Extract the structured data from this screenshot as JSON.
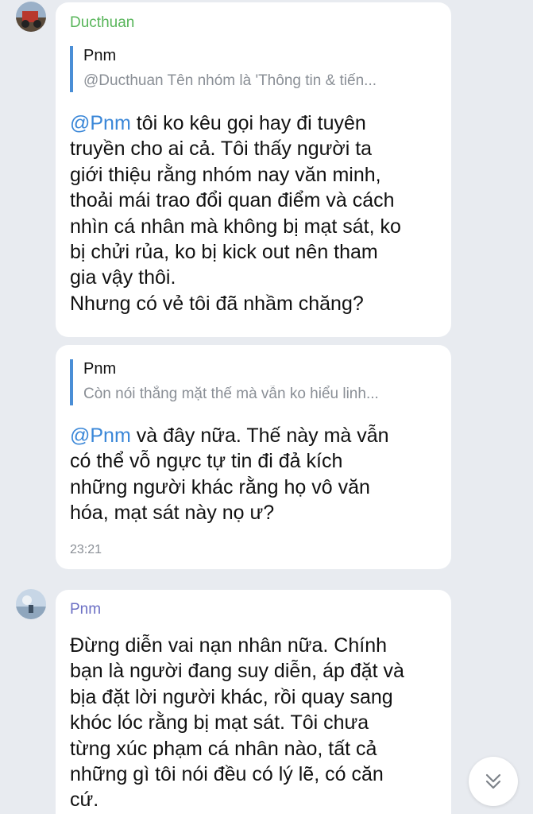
{
  "messages": [
    {
      "sender": "Ducthuan",
      "sender_color": "#58b55a",
      "reply_to": {
        "author": "Pnm",
        "text": "@Ducthuan Tên nhóm là 'Thông tin & tiến..."
      },
      "mention": "@Pnm",
      "lines": [
        " tôi ko kêu gọi hay đi tuyên",
        "truyền cho ai cả. Tôi thấy người ta",
        "giới thiệu rằng nhóm nay văn minh,",
        "thoải mái trao đổi quan điểm và cách",
        "nhìn cá nhân mà không bị mạt sát, ko",
        "bị chửi rủa, ko bị kick out nên tham",
        "gia vậy thôi.",
        "Nhưng có vẻ tôi đã nhầm chăng?"
      ]
    },
    {
      "reply_to": {
        "author": "Pnm",
        "text": "Còn nói thẳng mặt thế mà vẫn ko hiểu linh..."
      },
      "mention": "@Pnm",
      "lines": [
        " và đây nữa. Thế này mà vẫn",
        "có thể vỗ ngực tự tin đi đả kích",
        "những người khác rằng họ vô văn",
        "hóa, mạt sát này nọ ư?"
      ],
      "time": "23:21"
    },
    {
      "sender": "Pnm",
      "sender_color": "#6b6fc4",
      "lines": [
        "Đừng diễn vai nạn nhân nữa. Chính",
        "bạn là người đang suy diễn, áp đặt và",
        "bịa đặt lời người khác, rồi quay sang",
        "khóc lóc rằng bị mạt sát. Tôi chưa",
        "từng xúc phạm cá nhân nào, tất cả",
        "những gì tôi nói đều có lý lẽ, có căn",
        "cứ."
      ]
    }
  ],
  "icons": {
    "scroll_down": "double-chevron-down-icon",
    "avatar_ducthuan": "avatar-photo",
    "avatar_pnm": "avatar-photo"
  }
}
